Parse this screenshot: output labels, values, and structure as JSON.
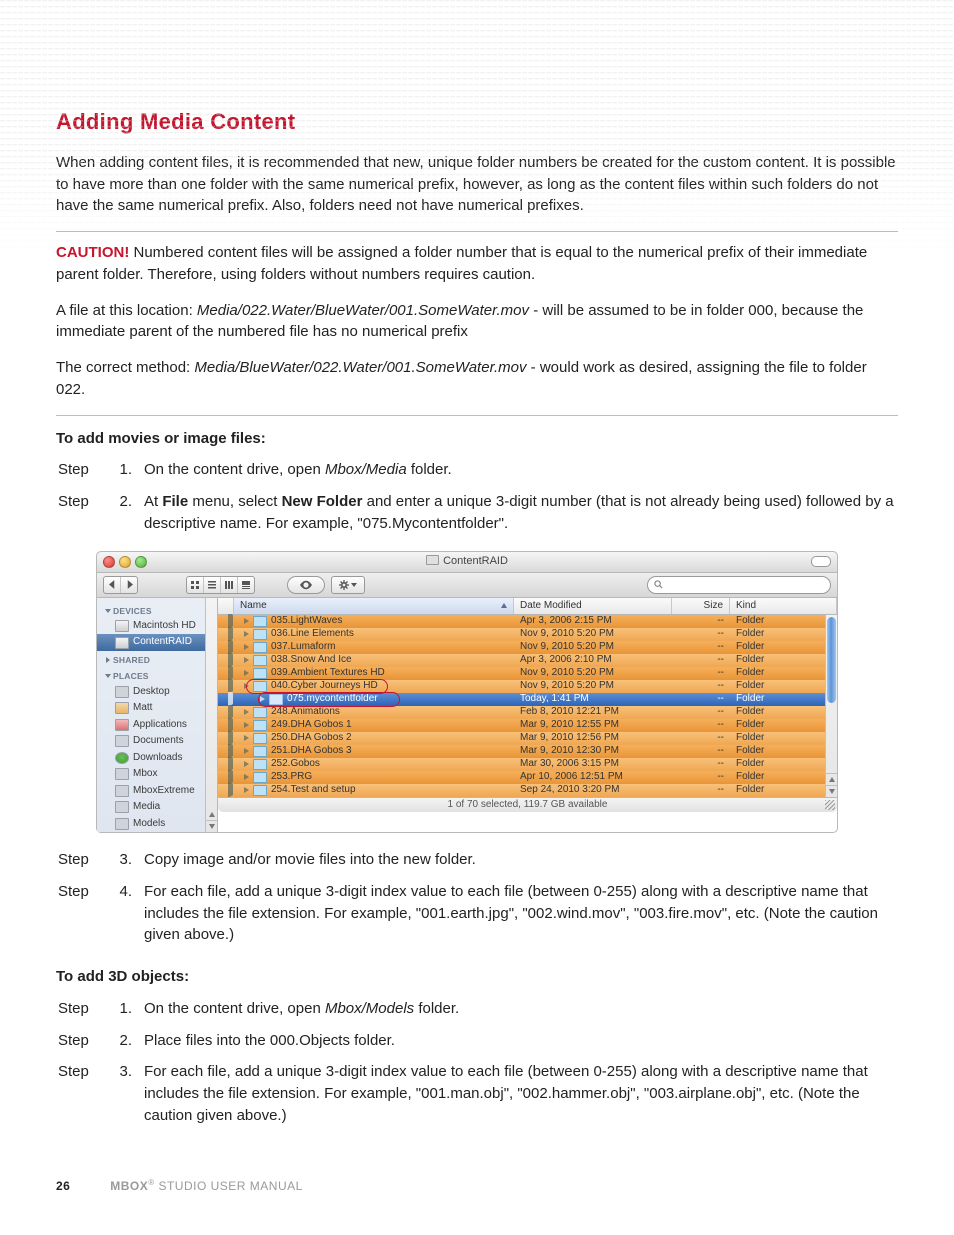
{
  "title": "Adding Media Content",
  "p1": "When adding content files, it is recommended that new, unique folder numbers be created for the custom content. It is possible to have more than one folder with the same numerical prefix, however, as long as the content files within such folders do not have the same numerical prefix. Also, folders need not have numerical prefixes.",
  "caution_label": "CAUTION!",
  "caution_text": "  Numbered content files will be assigned a folder number that is equal to the numerical prefix of their immediate parent folder. Therefore, using folders without numbers requires caution.",
  "ex1_a": "A file at this location: ",
  "ex1_em": "Media/022.Water/BlueWater/001.SomeWater.mov",
  "ex1_b": " - will be assumed to be in folder 000, because the immediate parent of the numbered file has no numerical prefix",
  "ex2_a": "The correct method: ",
  "ex2_em": "Media/BlueWater/022.Water/001.SomeWater.mov",
  "ex2_b": " - would work as desired, assigning the file to folder 022.",
  "howto1": "To add movies or image files:",
  "howto2": "To add 3D objects:",
  "step": "Step",
  "s1": [
    {
      "n": "1.",
      "t": [
        "On the content drive, open ",
        {
          "em": "Mbox/Media"
        },
        " folder."
      ]
    },
    {
      "n": "2.",
      "t": [
        "At ",
        {
          "b": "File"
        },
        " menu, select ",
        {
          "b": "New Folder"
        },
        " and enter a unique 3-digit number (that is not already being used) followed by a descriptive name. For example, \"075.Mycontentfolder\"."
      ]
    },
    {
      "n": "3.",
      "t": [
        "Copy image and/or movie files into the new folder."
      ]
    },
    {
      "n": "4.",
      "t": [
        "For each file, add a unique 3-digit index value to each file (between 0-255) along with a descriptive name that includes the file extension. For example, \"001.earth.jpg\", \"002.wind.mov\", \"003.fire.mov\", etc. (Note the caution given above.)"
      ]
    }
  ],
  "s2": [
    {
      "n": "1.",
      "t": [
        "On the content drive, open ",
        {
          "em": "Mbox/Models"
        },
        " folder."
      ]
    },
    {
      "n": "2.",
      "t": [
        "Place files into the 000.Objects folder."
      ]
    },
    {
      "n": "3.",
      "t": [
        "For each file, add a unique 3-digit index value to each file (between 0-255) along with a descriptive name that includes the file extension. For example, \"001.man.obj\", \"002.hammer.obj\", \"003.airplane.obj\", etc. (Note the caution given above.)"
      ]
    }
  ],
  "finder": {
    "window_title": "ContentRAID",
    "cols": {
      "name": "Name",
      "date": "Date Modified",
      "size": "Size",
      "kind": "Kind"
    },
    "size_dash": "--",
    "kind": "Folder",
    "sidebar": {
      "devices": "DEVICES",
      "shared": "SHARED",
      "places": "PLACES",
      "dev": [
        "Macintosh HD",
        "ContentRAID"
      ],
      "pl": [
        "Desktop",
        "Matt",
        "Applications",
        "Documents",
        "Downloads",
        "Mbox",
        "MboxExtreme",
        "Media",
        "Models"
      ]
    },
    "status": "1 of 70 selected, 119.7 GB available",
    "rows": [
      {
        "name": "035.LightWaves",
        "date": "Apr 3, 2006 2:15 PM"
      },
      {
        "name": "036.Line Elements",
        "date": "Nov 9, 2010 5:20 PM"
      },
      {
        "name": "037.Lumaform",
        "date": "Nov 9, 2010 5:20 PM"
      },
      {
        "name": "038.Snow And Ice",
        "date": "Apr 3, 2006 2:10 PM"
      },
      {
        "name": "039.Ambient Textures HD",
        "date": "Nov 9, 2010 5:20 PM"
      },
      {
        "name": "040.Cyber Journeys HD",
        "date": "Nov 9, 2010 5:20 PM"
      },
      {
        "name": "075.mycontentfolder",
        "date": "Today, 1:41 PM",
        "sel": true,
        "indent": true
      },
      {
        "name": "248.Animations",
        "date": "Feb 8, 2010 12:21 PM"
      },
      {
        "name": "249.DHA Gobos 1",
        "date": "Mar 9, 2010 12:55 PM"
      },
      {
        "name": "250.DHA Gobos 2",
        "date": "Mar 9, 2010 12:56 PM"
      },
      {
        "name": "251.DHA Gobos 3",
        "date": "Mar 9, 2010 12:30 PM"
      },
      {
        "name": "252.Gobos",
        "date": "Mar 30, 2006 3:15 PM"
      },
      {
        "name": "253.PRG",
        "date": "Apr 10, 2006 12:51 PM"
      },
      {
        "name": "254.Test and setup",
        "date": "Sep 24, 2010 3:20 PM"
      }
    ]
  },
  "footer": {
    "page": "26",
    "brand": "MBOX",
    "sup": "®",
    "rest": " STUDIO USER MANUAL"
  }
}
